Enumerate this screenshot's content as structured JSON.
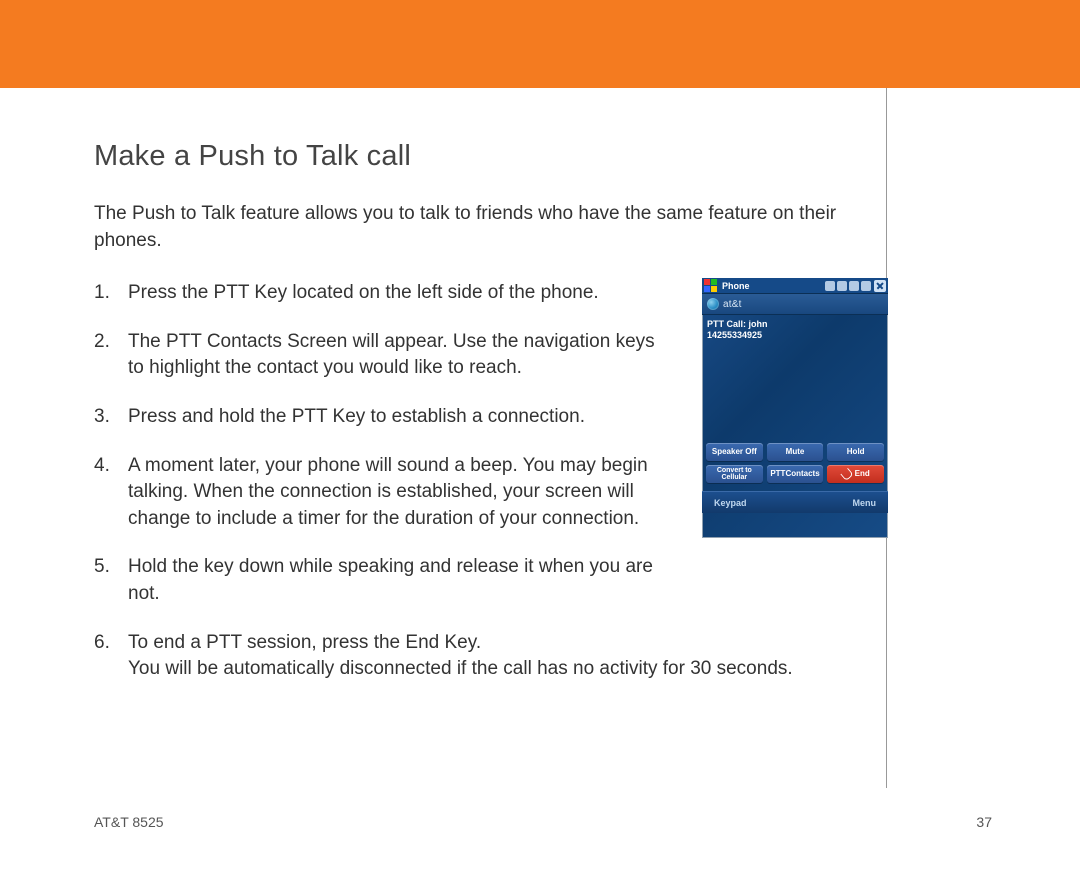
{
  "page": {
    "title": "Make a Push to Talk call",
    "intro": "The Push to Talk feature allows you to talk to friends who have the same feature on their phones.",
    "steps": [
      "Press the PTT Key located on the left side of the phone.",
      "The PTT Contacts Screen will appear. Use the navigation keys to highlight the contact you would like to reach.",
      "Press and hold the PTT Key to establish a connection.",
      "A moment later, your phone will sound a beep. You may begin talking. When the connection is established, your screen will change to include a timer for the duration of your connection.",
      "Hold the key down while speaking and release it when you are not.",
      "To end a PTT session, press the End Key.\nYou will be automatically disconnected if the call has no activity for 30 seconds."
    ],
    "footer_left": "AT&T 8525",
    "footer_right": "37"
  },
  "phone": {
    "topbar_title": "Phone",
    "brand": "at&t",
    "call_label": "PTT Call: john",
    "call_number": "14255334925",
    "buttons": {
      "speaker": "Speaker Off",
      "mute": "Mute",
      "hold": "Hold",
      "convert_l1": "Convert to",
      "convert_l2": "Cellular",
      "contacts": "PTTContacts",
      "end": "End"
    },
    "softkeys": {
      "left": "Keypad",
      "right": "Menu"
    }
  }
}
